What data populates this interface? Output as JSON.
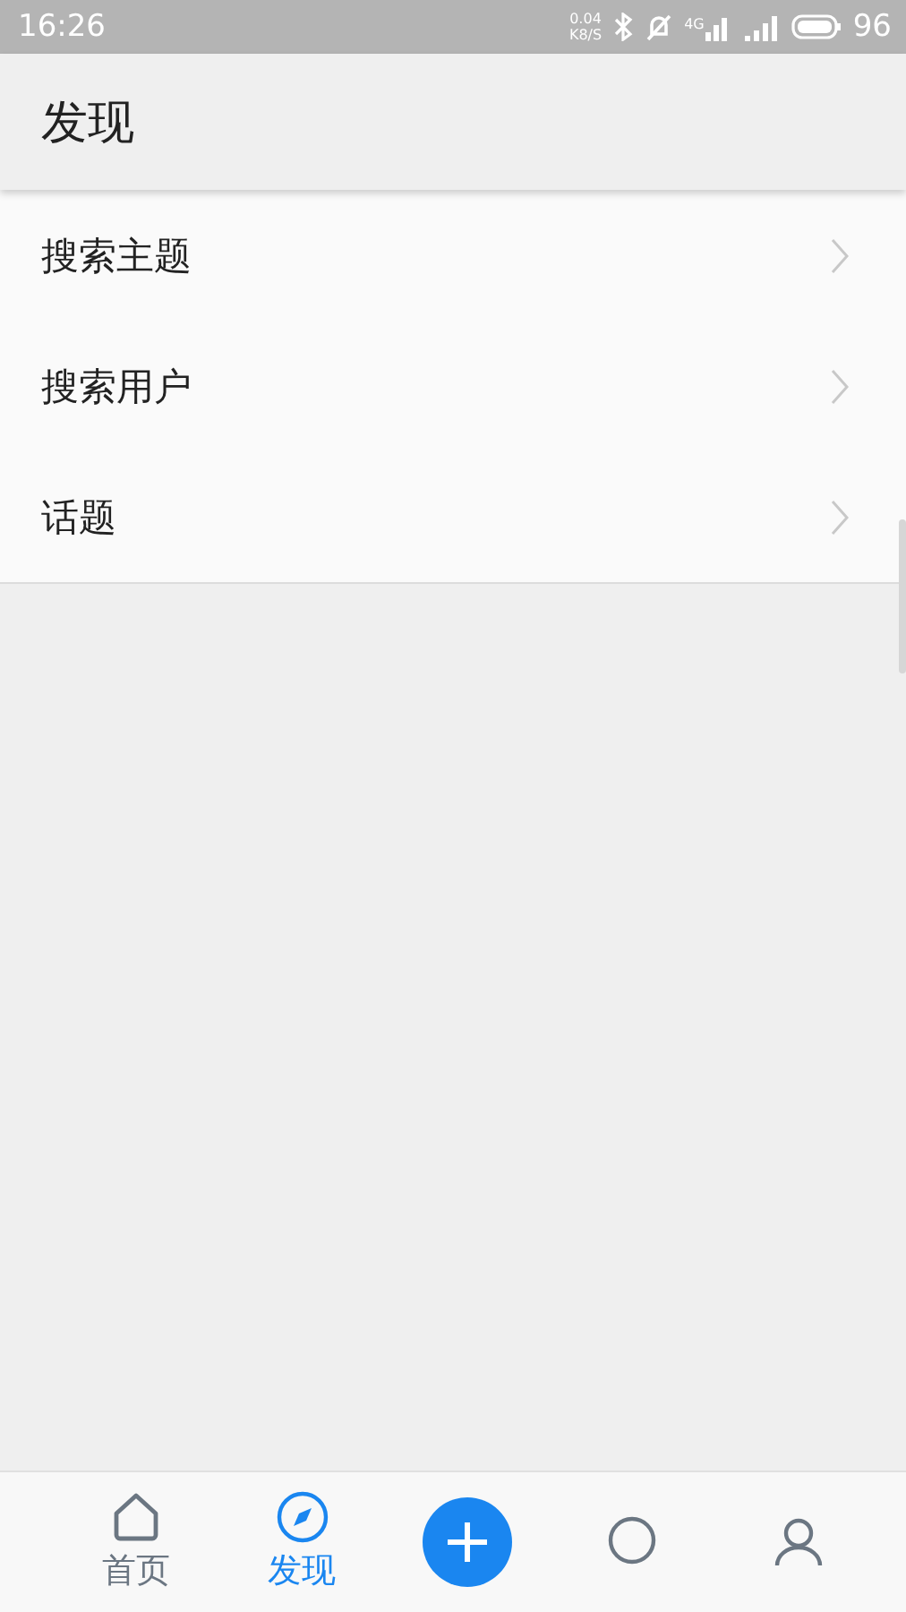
{
  "status_bar": {
    "time": "16:26",
    "speed": "0.04",
    "speed_unit": "K8/S",
    "network": "4G",
    "battery": "96"
  },
  "header": {
    "title": "发现"
  },
  "menu": [
    {
      "label": "搜索主题"
    },
    {
      "label": "搜索用户"
    },
    {
      "label": "话题"
    }
  ],
  "tab_bar": [
    {
      "kind": "home",
      "label": "首页",
      "selected": false
    },
    {
      "kind": "discover",
      "label": "发现",
      "selected": true
    },
    {
      "kind": "add",
      "selected": false
    },
    {
      "kind": "messages",
      "selected": false
    },
    {
      "kind": "profile",
      "selected": false
    }
  ]
}
